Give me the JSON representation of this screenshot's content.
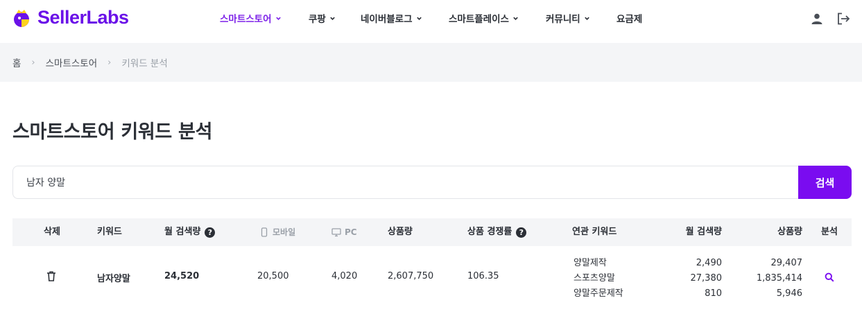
{
  "brand": {
    "name": "SellerLabs",
    "accent": "#6a11e8"
  },
  "nav": [
    {
      "label": "스마트스토어",
      "active": true,
      "dropdown": true
    },
    {
      "label": "쿠팡",
      "active": false,
      "dropdown": true
    },
    {
      "label": "네이버블로그",
      "active": false,
      "dropdown": true
    },
    {
      "label": "스마트플레이스",
      "active": false,
      "dropdown": true
    },
    {
      "label": "커뮤니티",
      "active": false,
      "dropdown": true
    },
    {
      "label": "요금제",
      "active": false,
      "dropdown": false
    }
  ],
  "header_icons": [
    "user-icon",
    "logout-icon"
  ],
  "breadcrumb": [
    "홈",
    "스마트스토어",
    "키워드 분석"
  ],
  "page_title": "스마트스토어 키워드 분석",
  "search": {
    "value": "남자 양말",
    "button_label": "검색",
    "button_color": "#7a0cf0"
  },
  "table": {
    "headers": {
      "delete": "삭제",
      "keyword": "키워드",
      "monthly_search": "월 검색량",
      "mobile": "모바일",
      "pc": "PC",
      "product_count": "상품량",
      "competition": "상품 경쟁률",
      "related_keyword": "연관 키워드",
      "related_monthly_search": "월 검색량",
      "related_product_count": "상품량",
      "analysis": "분석"
    },
    "rows": [
      {
        "keyword": "남자양말",
        "monthly_search": "24,520",
        "mobile": "20,500",
        "pc": "4,020",
        "product_count": "2,607,750",
        "competition": "106.35",
        "related": [
          {
            "keyword": "양말제작",
            "search": "2,490",
            "products": "29,407"
          },
          {
            "keyword": "스포츠양말",
            "search": "27,380",
            "products": "1,835,414"
          },
          {
            "keyword": "양말주문제작",
            "search": "810",
            "products": "5,946"
          }
        ]
      }
    ]
  }
}
